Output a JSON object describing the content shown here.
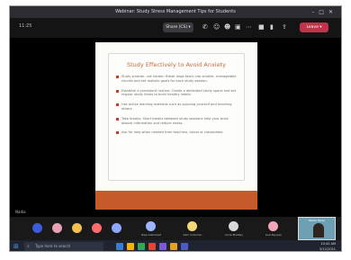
{
  "window": {
    "title": "Webinar: Study Stress Management Tips for Students",
    "controls": [
      "–",
      "□",
      "✕"
    ]
  },
  "toolbar": {
    "elapsed": "11:25",
    "share_label": "Share (CS) ▾",
    "icons": [
      "chat-icon",
      "people-icon",
      "reactions-icon",
      "rooms-icon",
      "more-icon",
      "camera-icon",
      "mic-icon",
      "share-icon"
    ],
    "leave_label": "Leave ▾"
  },
  "slide": {
    "title": "Study Effectively to Avoid Anxiety",
    "bullets": [
      "Study smarter, not harder: Break large tasks into smaller, manageable chunks and set realistic goals for each study session.",
      "Establish a consistent routine: Create a dedicated study space and set regular study times to build healthy habits.",
      "Use active learning methods such as quizzing yourself and teaching others.",
      "Take breaks: Short breaks between study sessions help your brain absorb information and reduce stress.",
      "Ask for help when needed from teachers, tutors or classmates."
    ]
  },
  "stage": {
    "presenter_caption": "Nadia"
  },
  "participants": {
    "small": [
      {
        "color": "#3b5bdb",
        "name": ""
      },
      {
        "color": "#e8a0b4",
        "name": ""
      },
      {
        "color": "#f2c14e",
        "name": ""
      },
      {
        "color": "#ff6b6b",
        "name": ""
      },
      {
        "color": "#8fa8ff",
        "name": ""
      }
    ],
    "named": [
      {
        "color": "#9bb6ff",
        "name": "Raja Alshareef"
      },
      {
        "color": "#f5d77a",
        "name": "Sam Coleman"
      },
      {
        "color": "#d9d9d9",
        "name": "Anna Bradley"
      },
      {
        "color": "#f2a6b8",
        "name": "Lisa Nguyen"
      }
    ],
    "video": {
      "name": "Nadia Perez"
    }
  },
  "taskbar": {
    "search_placeholder": "Type here to search",
    "apps": [
      "#3a7bd5",
      "#f4b400",
      "#34a853",
      "#ea4335",
      "#7b5cd6",
      "#e5a11b",
      "#5059c9"
    ],
    "time": "10:42 AM",
    "date": "5/12/2021"
  }
}
